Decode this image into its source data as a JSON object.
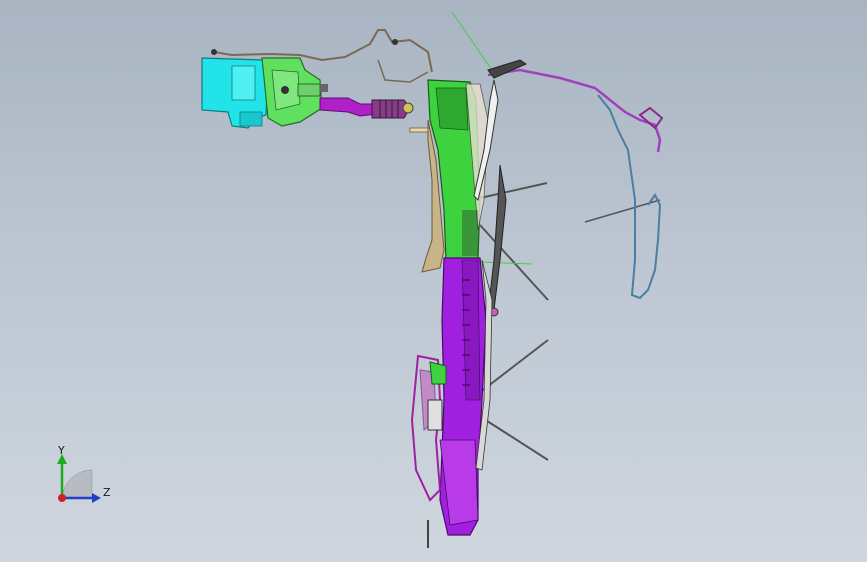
{
  "viewport": {
    "background_top": "#a9b4c2",
    "background_bottom": "#cfd6de"
  },
  "triad": {
    "y_label": "Y",
    "z_label": "Z",
    "y_color": "#1faa1f",
    "z_color": "#1f3fcc",
    "x_color": "#d02020"
  },
  "model": {
    "parts": [
      {
        "name": "washer-reservoir",
        "color": "#22e3e8"
      },
      {
        "name": "reservoir-bracket",
        "color": "#5fe05f"
      },
      {
        "name": "filler-neck",
        "color": "#b020c8"
      },
      {
        "name": "cowl-upper-panel",
        "color": "#3fd23f"
      },
      {
        "name": "cowl-lower-panel",
        "color": "#a020e0"
      },
      {
        "name": "seal-strip",
        "color": "#c9b48a"
      },
      {
        "name": "wiper-blades",
        "color": "#3a3a3a"
      },
      {
        "name": "washer-hose",
        "color": "#a040c0"
      }
    ]
  }
}
